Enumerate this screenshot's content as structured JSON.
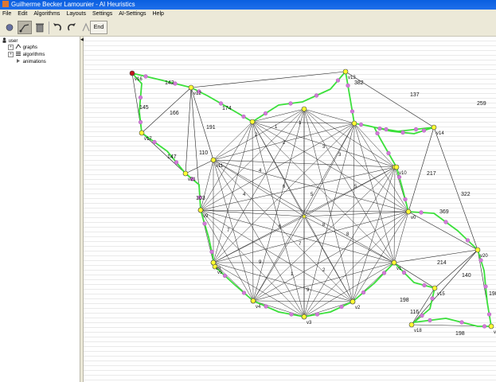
{
  "window": {
    "title": "Guilherme Becker Lamounier - AI Heuristics"
  },
  "menu": [
    "File",
    "Edit",
    "Algorithms",
    "Layouts",
    "Settings",
    "AI-Settings",
    "Help"
  ],
  "toolbar": {
    "end_label": "End"
  },
  "tree": {
    "root": "user",
    "items": [
      {
        "label": "graphs",
        "icon": "graph-icon",
        "expandable": true
      },
      {
        "label": "algorithms",
        "icon": "list-icon",
        "expandable": true
      },
      {
        "label": "animations",
        "icon": "animation-icon",
        "expandable": false
      }
    ]
  },
  "graph": {
    "vertex_labels": [
      "v0",
      "v1",
      "v2",
      "v3",
      "v4",
      "v5",
      "v8",
      "v9",
      "v10",
      "v11",
      "v12",
      "v13",
      "v14",
      "v15",
      "v16",
      "v17",
      "v18",
      "v19",
      "v20",
      "v21"
    ],
    "edge_weights": [
      "382",
      "137",
      "259",
      "174",
      "166",
      "142",
      "145",
      "147",
      "191",
      "110",
      "217",
      "322",
      "369",
      "214",
      "140",
      "198",
      "116",
      "198",
      "198",
      "103"
    ],
    "inner_weights": [
      "1",
      "2",
      "3",
      "4",
      "5",
      "6",
      "7",
      "8",
      "9"
    ]
  }
}
